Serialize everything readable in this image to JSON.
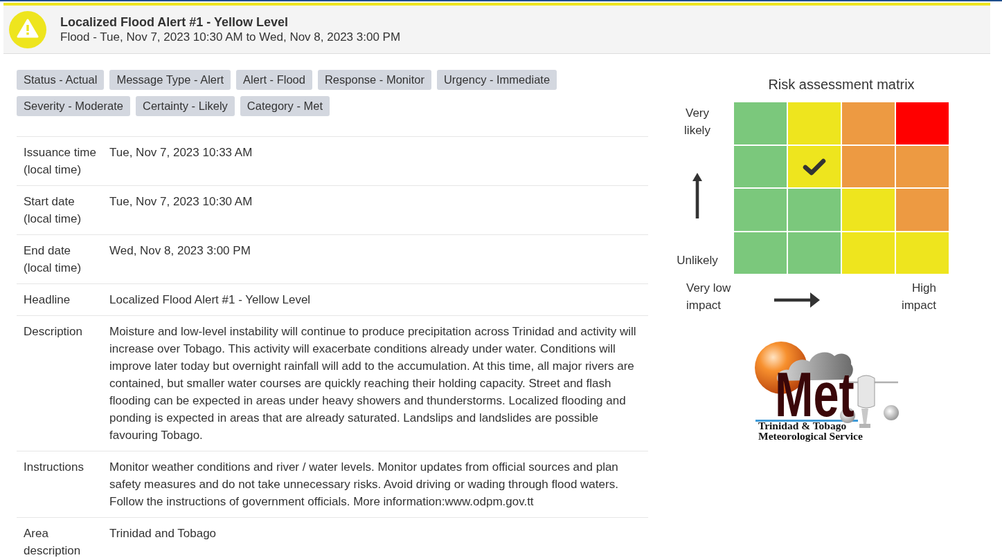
{
  "alert_header": {
    "title": "Localized Flood Alert #1 - Yellow Level",
    "subtitle": "Flood - Tue, Nov 7, 2023 10:30 AM to Wed, Nov 8, 2023 3:00 PM"
  },
  "tags": [
    "Status - Actual",
    "Message Type - Alert",
    "Alert - Flood",
    "Response - Monitor",
    "Urgency - Immediate",
    "Severity - Moderate",
    "Certainty - Likely",
    "Category - Met"
  ],
  "details": [
    {
      "label": "Issuance time (local time)",
      "value": "Tue, Nov 7, 2023 10:33 AM"
    },
    {
      "label": "Start date (local time)",
      "value": "Tue, Nov 7, 2023 10:30 AM"
    },
    {
      "label": "End date (local time)",
      "value": "Wed, Nov 8, 2023 3:00 PM"
    },
    {
      "label": "Headline",
      "value": "Localized Flood Alert #1 - Yellow Level"
    },
    {
      "label": "Description",
      "value": "Moisture and low-level instability will continue to produce precipitation across Trinidad and activity will increase over Tobago. This activity will exacerbate conditions already under water. Conditions will improve later today but overnight rainfall will add to the accumulation. At this time, all major rivers are contained, but smaller water courses are quickly reaching their holding capacity. Street and flash flooding can be expected in areas under heavy showers and thunderstorms. Localized flooding and ponding is expected in areas that are already saturated. Landslips and landslides are possible favouring Tobago."
    },
    {
      "label": "Instructions",
      "value": "Monitor weather conditions and river / water levels. Monitor updates from official sources and plan safety measures and do not take unnecessary risks. Avoid driving or wading through flood waters. Follow the instructions of government officials. More information:www.odpm.gov.tt"
    },
    {
      "label": "Area description",
      "value": "Trinidad and Tobago"
    }
  ],
  "risk_matrix": {
    "title": "Risk assessment matrix",
    "y_axis": {
      "top_label": "Very likely",
      "bottom_label": "Unlikely"
    },
    "x_axis": {
      "left_label": "Very low impact",
      "right_label": "High impact"
    },
    "rows": [
      {
        "cells": [
          {
            "color": "#7bc87c",
            "selected": false
          },
          {
            "color": "#eee51e",
            "selected": false
          },
          {
            "color": "#ed9a42",
            "selected": false
          },
          {
            "color": "#ff0000",
            "selected": false
          }
        ]
      },
      {
        "cells": [
          {
            "color": "#7bc87c",
            "selected": false
          },
          {
            "color": "#eee51e",
            "selected": true
          },
          {
            "color": "#ed9a42",
            "selected": false
          },
          {
            "color": "#ed9a42",
            "selected": false
          }
        ]
      },
      {
        "cells": [
          {
            "color": "#7bc87c",
            "selected": false
          },
          {
            "color": "#7bc87c",
            "selected": false
          },
          {
            "color": "#eee51e",
            "selected": false
          },
          {
            "color": "#ed9a42",
            "selected": false
          }
        ]
      },
      {
        "cells": [
          {
            "color": "#7bc87c",
            "selected": false
          },
          {
            "color": "#7bc87c",
            "selected": false
          },
          {
            "color": "#eee51e",
            "selected": false
          },
          {
            "color": "#eee51e",
            "selected": false
          }
        ]
      }
    ]
  },
  "logo": {
    "wordmark": "Met",
    "caption_lines": [
      "Trinidad & Tobago",
      "Meteorological Service"
    ]
  }
}
